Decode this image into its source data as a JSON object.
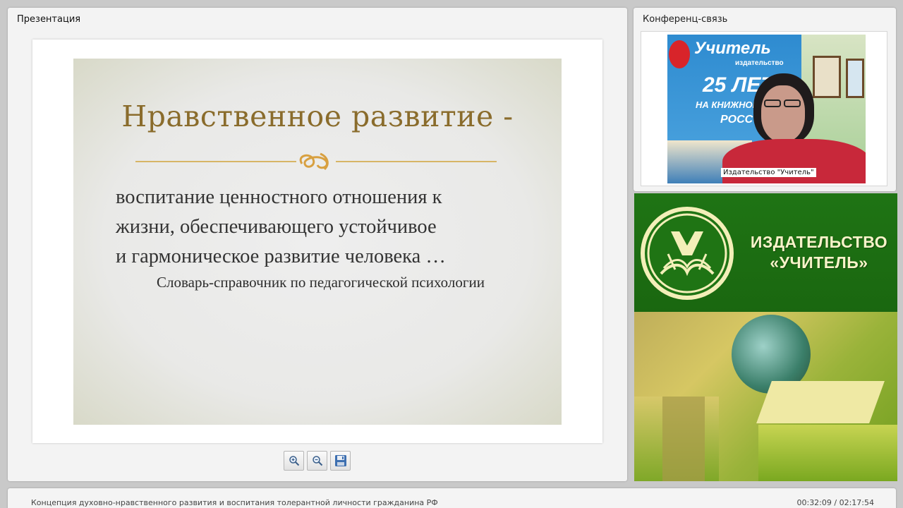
{
  "presentation": {
    "panel_title": "Презентация",
    "slide": {
      "title": "Нравственное развитие -",
      "body_lines": [
        "воспитание ценностного отношения к",
        "жизни, обеспечивающего устойчивое",
        "и гармоническое развитие человека …"
      ],
      "source": "Словарь-справочник по педагогической психологии"
    },
    "toolbar": {
      "zoom_in_icon": "zoom-in-icon",
      "zoom_out_icon": "zoom-out-icon",
      "save_icon": "floppy-disk-icon"
    }
  },
  "conference": {
    "panel_title": "Конференц-связь",
    "video_label": "Издательство \"Учитель\"",
    "poster": {
      "brand": "Учитель",
      "subbrand": "издательство",
      "years": "25 ЛЕТ",
      "slogan": "НА КНИЖНОМ Р",
      "slogan2": "РОСС"
    }
  },
  "publisher_ad": {
    "line1": "ИЗДАТЕЛЬСТВО",
    "line2": "«УЧИТЕЛЬ»"
  },
  "status_bar": {
    "title": "Концепция духовно-нравственного развития и воспитания толерантной личности гражданина РФ",
    "time": "00:32:09 / 02:17:54"
  },
  "colors": {
    "slide_title": "#8a6c2c",
    "ad_green": "#1f7414",
    "ad_text": "#f8f3c9"
  }
}
